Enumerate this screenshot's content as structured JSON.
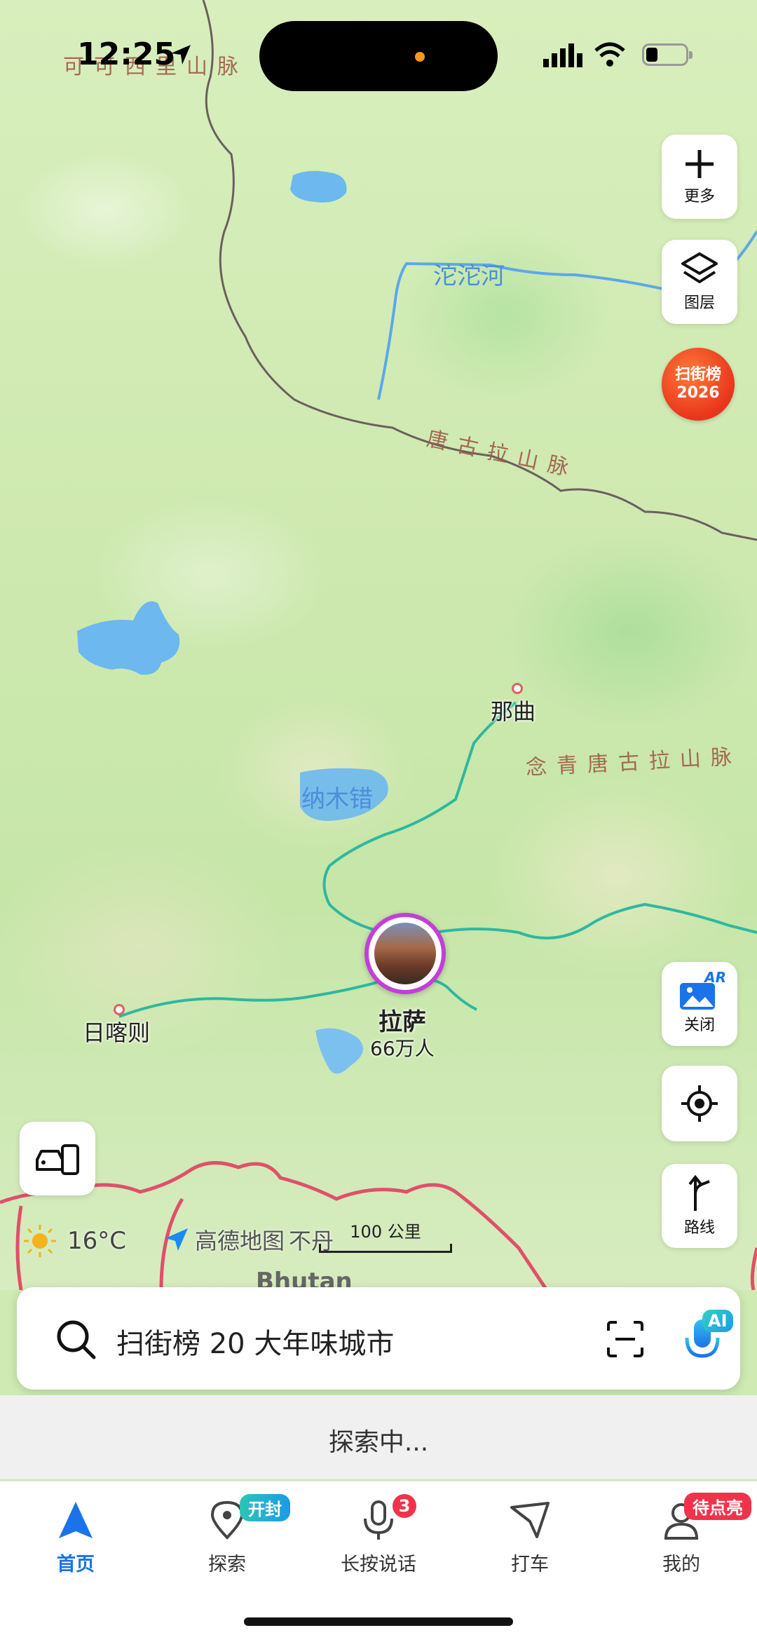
{
  "status_bar": {
    "time": "12:25"
  },
  "map_labels": {
    "mountain_top": "可可西里山脉",
    "mountain_tanggula": "唐古拉山脉",
    "mountain_nyenchen": "念青唐古拉山脉",
    "river_tuotuo": "沱沱河",
    "lake_namtso": "纳木错",
    "city_nagqu": "那曲",
    "city_lhasa": "拉萨",
    "city_lhasa_pop": "66万人",
    "city_shigatse": "日喀则",
    "country_bhutan": "Bhutan"
  },
  "side_buttons": {
    "more": "更多",
    "layers": "图层",
    "scan_line1": "扫街榜",
    "scan_line2": "2026",
    "ar_badge": "AR",
    "ar_close": "关闭",
    "route": "路线"
  },
  "weather": {
    "temp": "16°C"
  },
  "brand": {
    "name": "高德地图",
    "extra": "不丹"
  },
  "scale": {
    "label": "100 公里"
  },
  "search": {
    "query": "扫街榜 20 大年味城市",
    "ai_badge": "AI"
  },
  "loading": "探索中...",
  "tabs": [
    {
      "label": "首页"
    },
    {
      "label": "探索",
      "badge": "开封"
    },
    {
      "label": "长按说话",
      "badge": "3"
    },
    {
      "label": "打车"
    },
    {
      "label": "我的",
      "badge": "待点亮"
    }
  ],
  "colors": {
    "accent": "#1a73e8",
    "border_line": "#7a6a6a",
    "highway": "#2eb8a0",
    "red_border": "#e0506a"
  }
}
